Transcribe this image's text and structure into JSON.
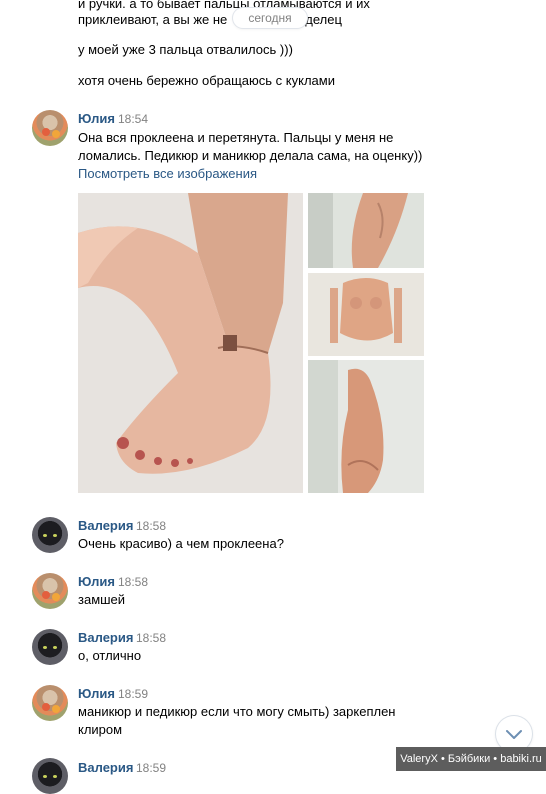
{
  "date_separator": "сегодня",
  "top_messages": [
    "и ручки. а то бывает пальцы отламываются и их",
    "приклеивают, а вы же не",
    "делец",
    "у моей уже 3 пальца отвалилось )))",
    "хотя очень бережно обращаюсь с куклами"
  ],
  "messages": [
    {
      "author": "Юлия",
      "time": "18:54",
      "lines": [
        "Она вся проклеена и перетянута. Пальцы у меня не",
        "ломались. Педикюр и маникюр делала сама, на оценку))"
      ],
      "link": "Посмотреть все изображения"
    },
    {
      "author": "Валерия",
      "time": "18:58",
      "lines": [
        "Очень красиво) а чем проклеена?"
      ]
    },
    {
      "author": "Юлия",
      "time": "18:58",
      "lines": [
        "замшей"
      ]
    },
    {
      "author": "Валерия",
      "time": "18:58",
      "lines": [
        "о, отлично"
      ]
    },
    {
      "author": "Юлия",
      "time": "18:59",
      "lines": [
        "маникюр и педикюр если что могу смыть) заркеплен",
        "клиром"
      ]
    },
    {
      "author": "Валерия",
      "time": "18:59",
      "lines": []
    }
  ],
  "photos": [
    {
      "icon": "doll-foot-photo"
    },
    {
      "icon": "doll-legs-photo"
    },
    {
      "icon": "doll-torso-photo"
    },
    {
      "icon": "doll-side-photo"
    }
  ],
  "watermark": "ValeryX • Бэйбики • babiki.ru",
  "colors": {
    "link": "#2a5885",
    "meta": "#828282",
    "background": "#ffffff"
  }
}
